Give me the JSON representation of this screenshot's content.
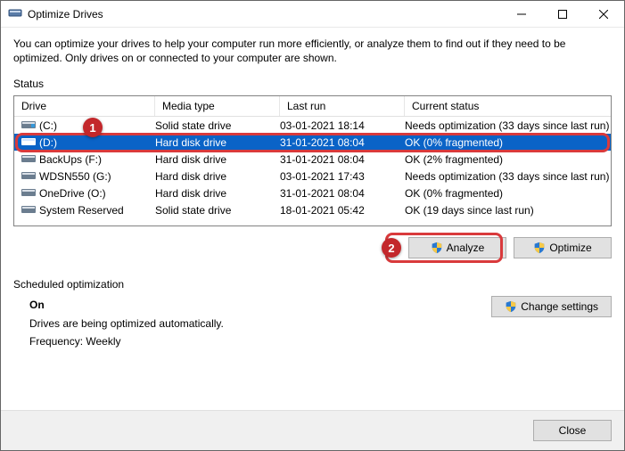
{
  "window": {
    "title": "Optimize Drives"
  },
  "intro": "You can optimize your drives to help your computer run more efficiently, or analyze them to find out if they need to be optimized. Only drives on or connected to your computer are shown.",
  "status_label": "Status",
  "table": {
    "headers": {
      "drive": "Drive",
      "media": "Media type",
      "last": "Last run",
      "status": "Current status"
    },
    "rows": [
      {
        "icon": "sys",
        "drive": "(C:)",
        "media": "Solid state drive",
        "last": "03-01-2021 18:14",
        "status": "Needs optimization (33 days since last run)",
        "selected": false
      },
      {
        "icon": "hdd",
        "drive": "(D:)",
        "media": "Hard disk drive",
        "last": "31-01-2021 08:04",
        "status": "OK (0% fragmented)",
        "selected": true
      },
      {
        "icon": "hdd",
        "drive": "BackUps (F:)",
        "media": "Hard disk drive",
        "last": "31-01-2021 08:04",
        "status": "OK (2% fragmented)",
        "selected": false
      },
      {
        "icon": "hdd",
        "drive": "WDSN550 (G:)",
        "media": "Hard disk drive",
        "last": "03-01-2021 17:43",
        "status": "Needs optimization (33 days since last run)",
        "selected": false
      },
      {
        "icon": "hdd",
        "drive": "OneDrive (O:)",
        "media": "Hard disk drive",
        "last": "31-01-2021 08:04",
        "status": "OK (0% fragmented)",
        "selected": false
      },
      {
        "icon": "hdd",
        "drive": "System Reserved",
        "media": "Solid state drive",
        "last": "18-01-2021 05:42",
        "status": "OK (19 days since last run)",
        "selected": false
      }
    ]
  },
  "buttons": {
    "analyze": "Analyze",
    "optimize": "Optimize",
    "change_settings": "Change settings",
    "close": "Close"
  },
  "scheduled": {
    "label": "Scheduled optimization",
    "on": "On",
    "desc": "Drives are being optimized automatically.",
    "freq": "Frequency: Weekly"
  },
  "annotations": {
    "one": "1",
    "two": "2"
  }
}
